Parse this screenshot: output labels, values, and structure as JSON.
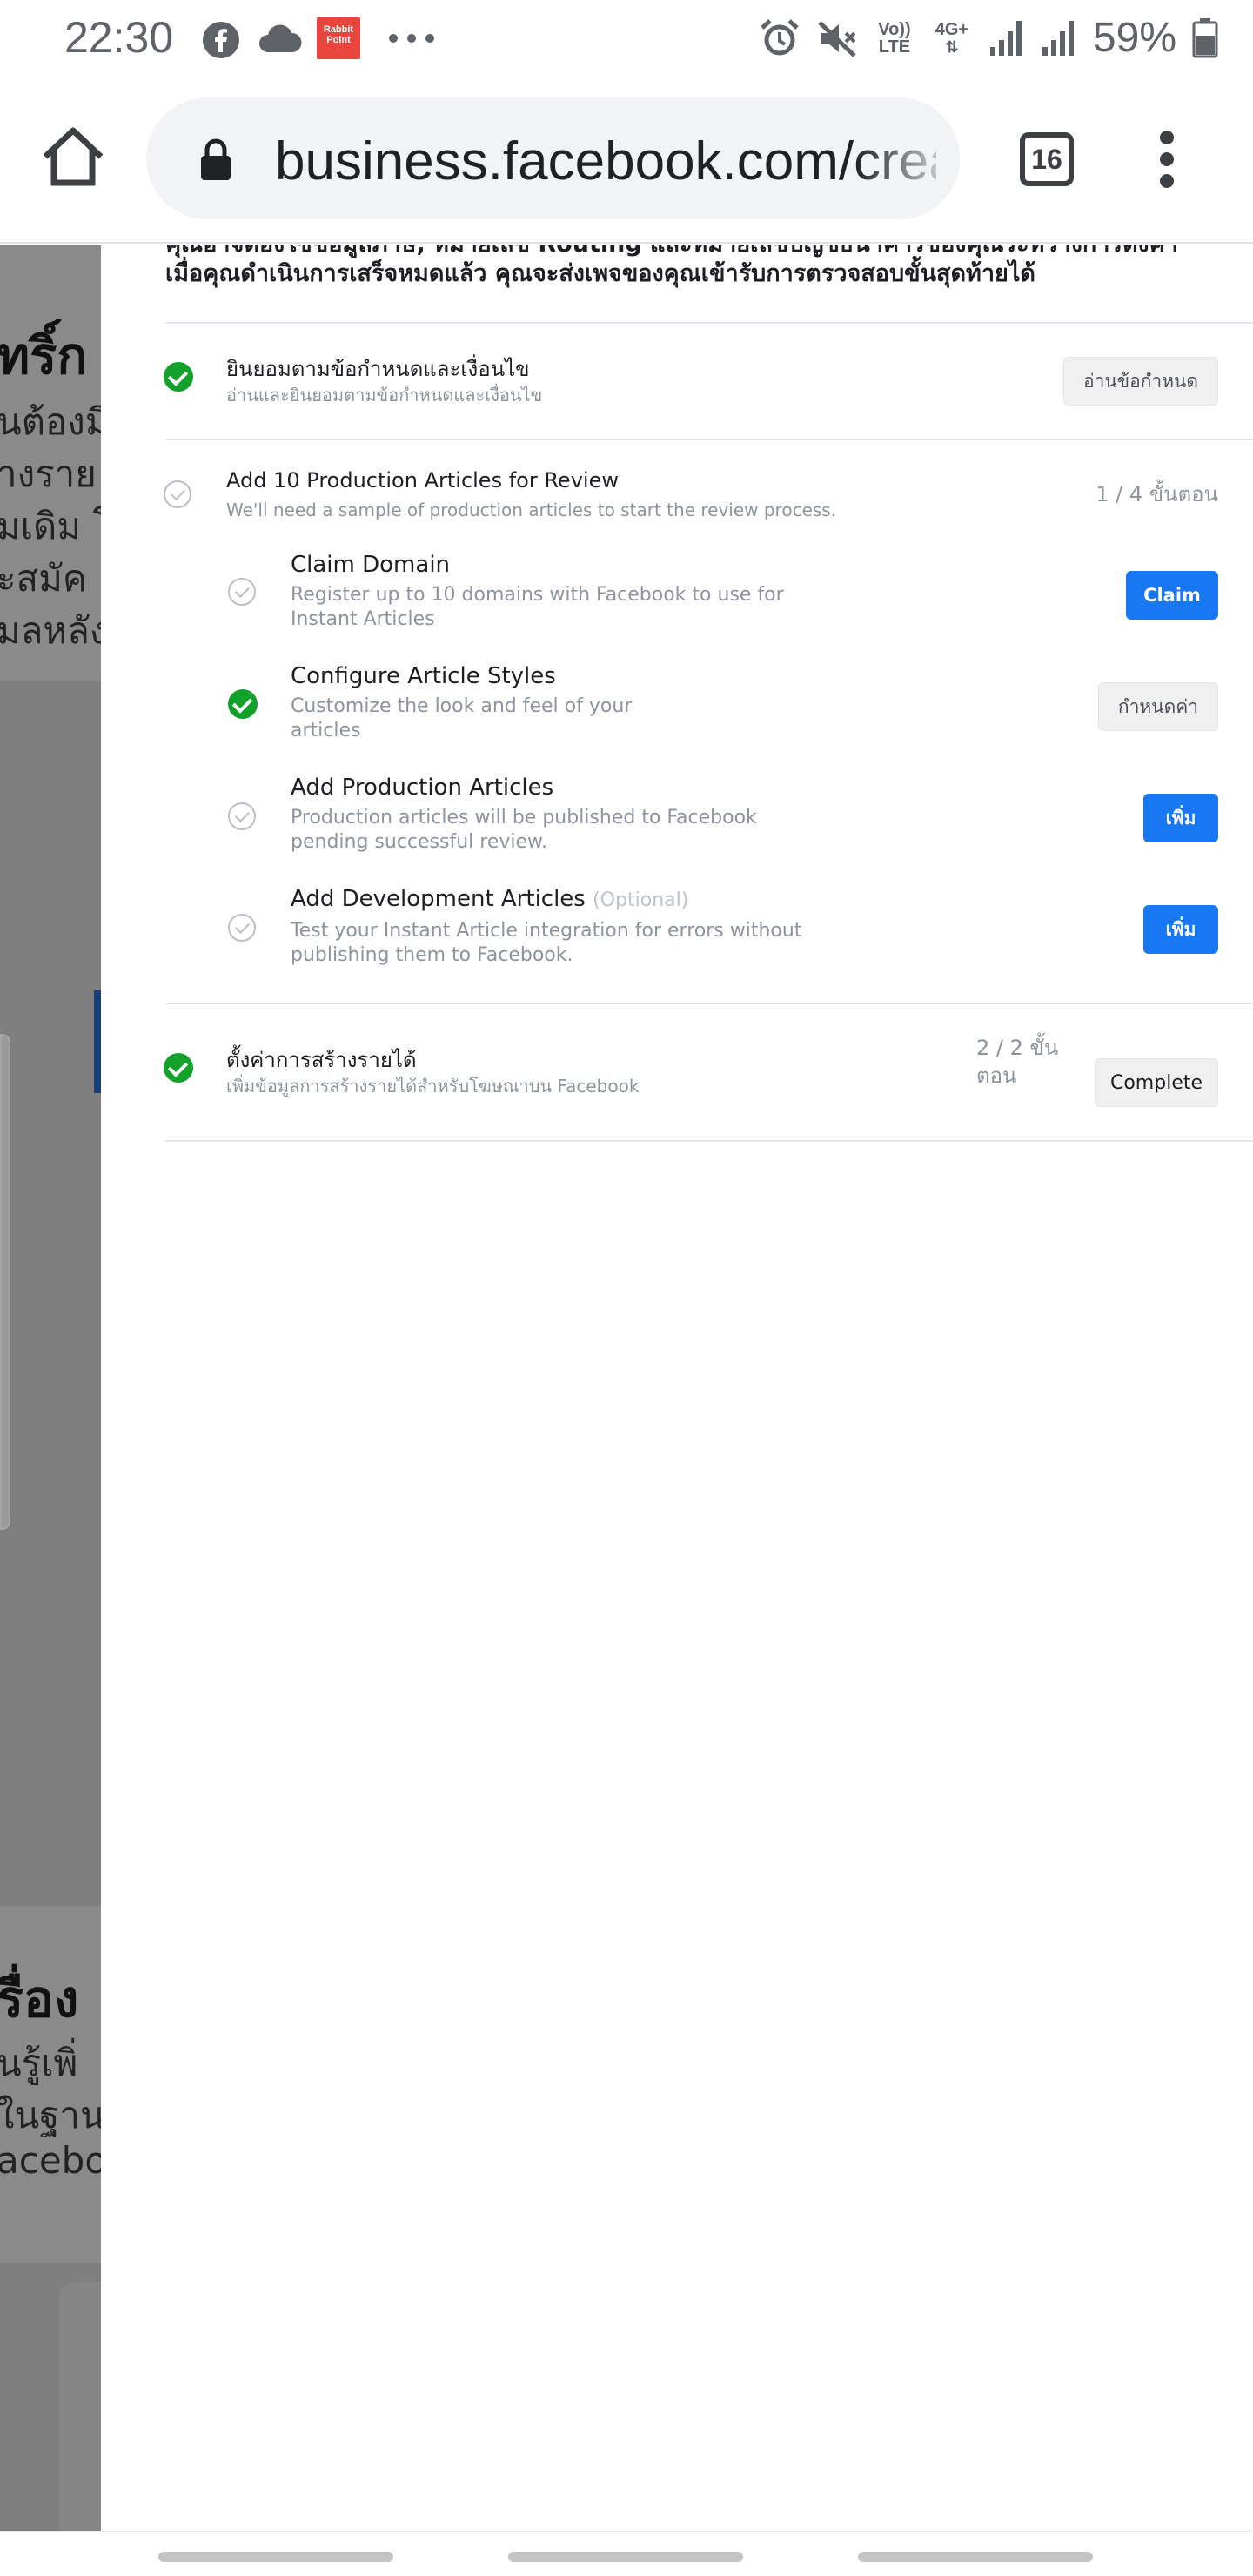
{
  "status_bar": {
    "time": "22:30",
    "notification_icons": [
      "facebook-icon",
      "cloud-icon",
      "rabbit-point-app-icon",
      "more-dots-icon"
    ],
    "app_badge_text": "Rabbit Point",
    "network_top": "Vo))",
    "network_bottom": "LTE",
    "data_type": "4G+",
    "battery_percent": "59%"
  },
  "browser": {
    "url": "business.facebook.com/creator",
    "tab_count": "16"
  },
  "background_page": {
    "fragments": [
      "ทริ์ก",
      "นต้องมี",
      "างราย",
      "มเดิม โ",
      "ะสมัค",
      "มลหลัง",
      "รื่อง",
      "นรู้เพิ่",
      "ในฐาน",
      "acebook"
    ]
  },
  "panel": {
    "intro_line1": "คุณอาจต้องใช้ข้อมูลภาษี, หมายเลข Routing และหมายเลขบัญชีธนาคารของคุณระหว่างการตั้งค่า",
    "intro_line2": "เมื่อคุณดำเนินการเสร็จหมดแล้ว คุณจะส่งเพจของคุณเข้ารับการตรวจสอบขั้นสุดท้ายได้",
    "terms": {
      "title": "ยินยอมตามข้อกำหนดและเงื่อนไข",
      "subtitle": "อ่านและยินยอมตามข้อกำหนดและเงื่อนไข",
      "button": "อ่านข้อกำหนด",
      "done": true
    },
    "production": {
      "title": "Add 10 Production Articles for Review",
      "subtitle": "We'll need a sample of production articles to start the review process.",
      "step_count": "1 / 4 ขั้นตอน",
      "done": false,
      "steps": [
        {
          "title": "Claim Domain",
          "optional": "",
          "desc_line1": "Register up to 10 domains with Facebook to use for",
          "desc_line2": "Instant Articles",
          "button": "Claim",
          "done": false
        },
        {
          "title": "Configure Article Styles",
          "optional": "",
          "desc_line1": "Customize the look and feel of your",
          "desc_line2": "articles",
          "button": "กำหนดค่า",
          "done": true
        },
        {
          "title": "Add Production Articles",
          "optional": "",
          "desc_line1": "Production articles will be published to Facebook",
          "desc_line2": "pending successful review.",
          "button": "เพิ่ม",
          "done": false
        },
        {
          "title": "Add Development Articles",
          "optional": "(Optional)",
          "desc_line1": "Test your Instant Article integration for errors without",
          "desc_line2": "publishing them to Facebook.",
          "button": "เพิ่ม",
          "done": false
        }
      ]
    },
    "monetization": {
      "title": "ตั้งค่าการสร้างรายได้",
      "subtitle": "เพิ่มข้อมูลการสร้างรายได้สำหรับโฆษณาบน Facebook",
      "step_count_line1": "2 / 2 ขั้น",
      "step_count_line2": "ตอน",
      "button": "Complete",
      "done": true
    }
  },
  "colors": {
    "primary_button": "#1877f2",
    "check_done": "#12a12a",
    "muted_text": "#8d949e",
    "overlay": "#7f7f7f"
  }
}
